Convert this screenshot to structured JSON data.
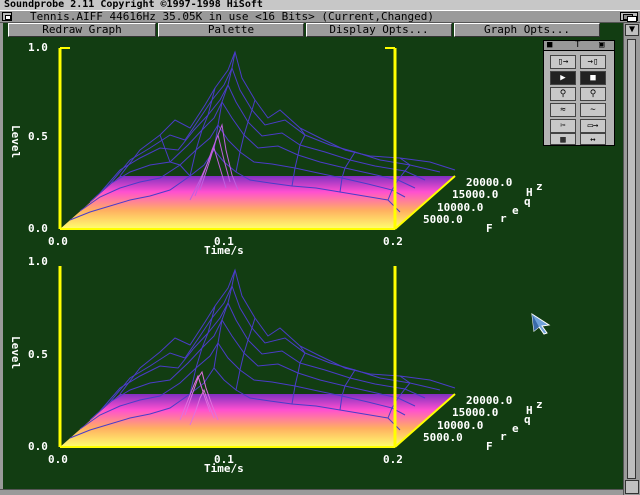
{
  "screen": {
    "title": "Soundprobe 2.11 Copyright ©1997-1998 HiSoft"
  },
  "window": {
    "title": "Tennis.AIFF 44616Hz 35.05K in use <16 Bits> (Current,Changed)"
  },
  "toolbar": {
    "redraw_label": "Redraw Graph",
    "palette_label": "Palette",
    "display_label": "Display Opts...",
    "graph_label": "Graph Opts..."
  },
  "graphs": [
    {
      "y_axis_label": "Level",
      "y_ticks": [
        "1.0",
        "0.5",
        "0.0"
      ],
      "x_ticks": [
        "0.0",
        "0.1",
        "0.2"
      ],
      "x_axis_label": "Time/s",
      "freq_ticks": [
        "20000.0",
        "15000.0",
        "10000.0",
        "5000.0"
      ],
      "freq_label": [
        "F",
        "r",
        "e",
        "q",
        "H",
        "z"
      ]
    },
    {
      "y_axis_label": "Level",
      "y_ticks": [
        "1.0",
        "0.5",
        "0.0"
      ],
      "x_ticks": [
        "0.0",
        "0.1",
        "0.2"
      ],
      "x_axis_label": "Time/s",
      "freq_ticks": [
        "20000.0",
        "15000.0",
        "10000.0",
        "5000.0"
      ],
      "freq_label": [
        "F",
        "r",
        "e",
        "q",
        "H",
        "z"
      ]
    }
  ],
  "palette": {
    "tab_label": "T"
  },
  "colors": {
    "background": "#123d12",
    "axis": "#ffff00",
    "mesh": "#4a3cc8",
    "floor_top": "#ff40ff",
    "floor_bottom": "#ffff66"
  }
}
